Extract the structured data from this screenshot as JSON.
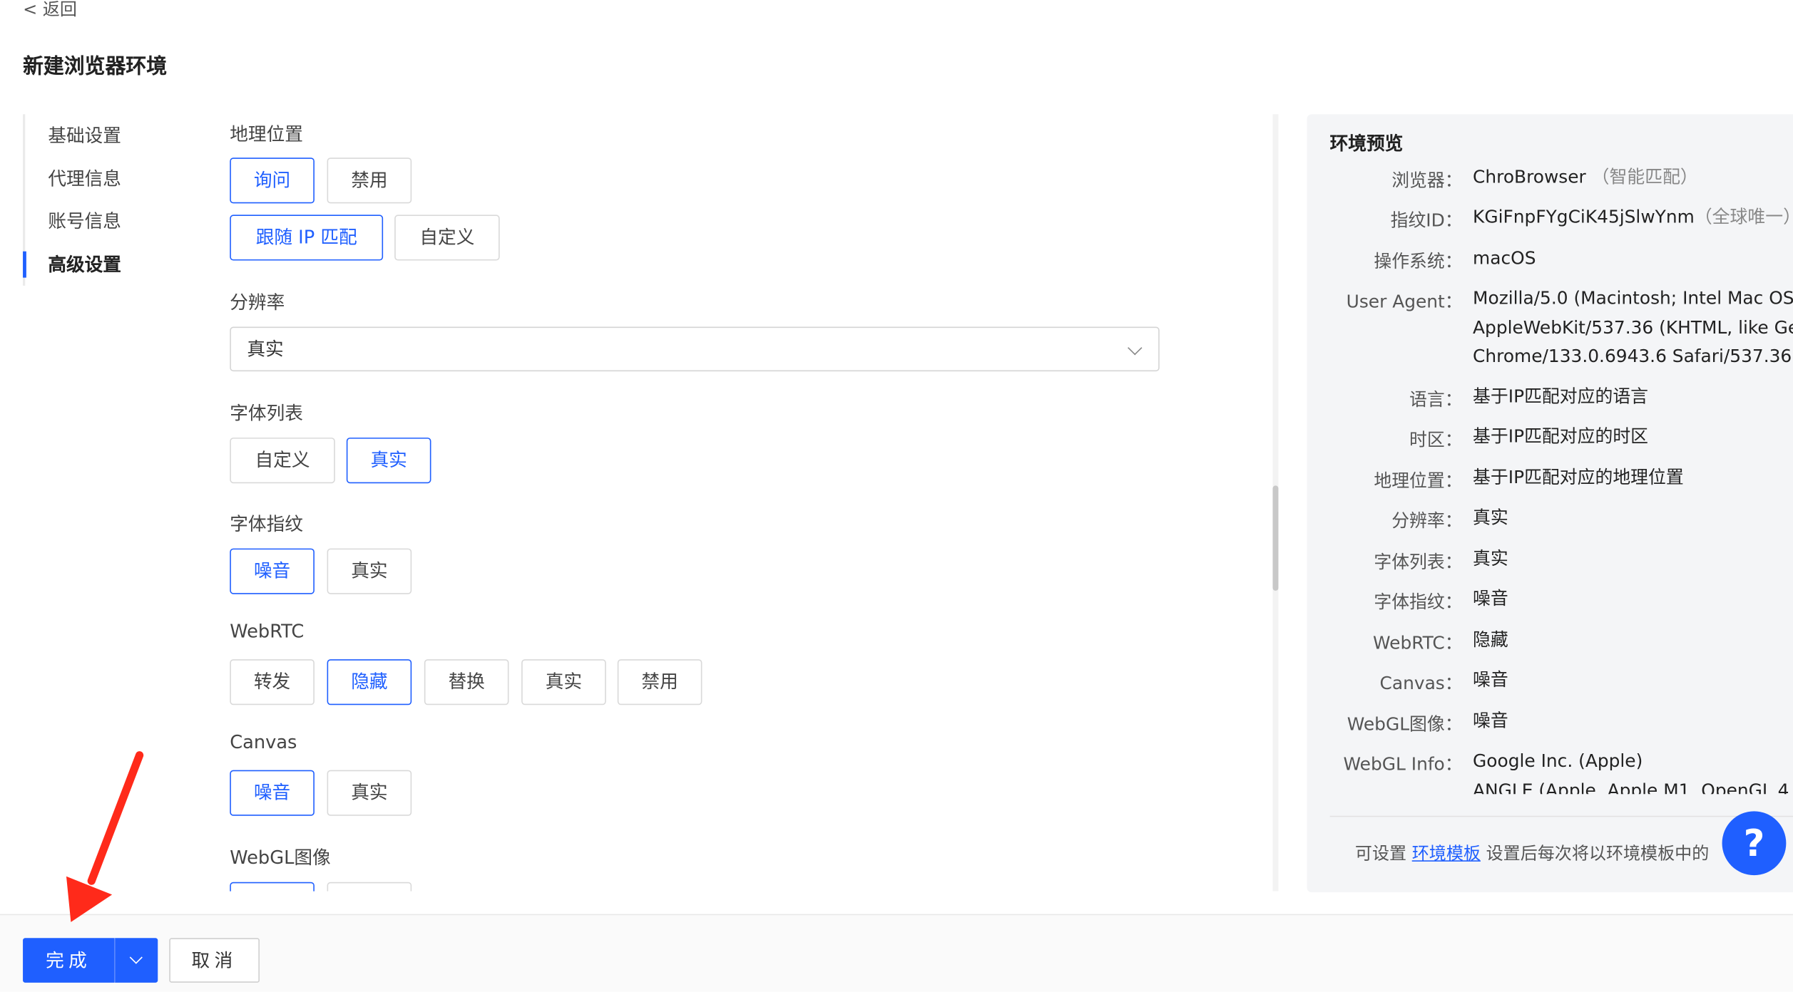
{
  "header": {
    "back_label": "< 返回",
    "title": "新建浏览器环境"
  },
  "nav": {
    "items": [
      {
        "label": "基础设置",
        "active": false
      },
      {
        "label": "代理信息",
        "active": false
      },
      {
        "label": "账号信息",
        "active": false
      },
      {
        "label": "高级设置",
        "active": true
      }
    ]
  },
  "form": {
    "geo": {
      "label": "地理位置",
      "option1": [
        "询问",
        "禁用"
      ],
      "option1_selected": "询问",
      "option2": [
        "跟随 IP 匹配",
        "自定义"
      ],
      "option2_selected": "跟随 IP 匹配"
    },
    "resolution": {
      "label": "分辨率",
      "value": "真实"
    },
    "font_list": {
      "label": "字体列表",
      "options": [
        "自定义",
        "真实"
      ],
      "selected": "真实"
    },
    "font_fp": {
      "label": "字体指纹",
      "options": [
        "噪音",
        "真实"
      ],
      "selected": "噪音"
    },
    "webrtc": {
      "label": "WebRTC",
      "options": [
        "转发",
        "隐藏",
        "替换",
        "真实",
        "禁用"
      ],
      "selected": "隐藏"
    },
    "canvas": {
      "label": "Canvas",
      "options": [
        "噪音",
        "真实"
      ],
      "selected": "噪音"
    },
    "webgl_image": {
      "label": "WebGL图像"
    }
  },
  "preview": {
    "title": "环境预览",
    "rows": [
      {
        "key": "浏览器：",
        "value": "ChroBrowser",
        "note": "（智能匹配）"
      },
      {
        "key": "指纹ID：",
        "value": "KGiFnpFYgCiK45jSlwYnm",
        "note": "（全球唯一）"
      },
      {
        "key": "操作系统：",
        "value": "macOS"
      },
      {
        "key": "User Agent：",
        "value": "Mozilla/5.0 (Macintosh; Intel Mac OS",
        "value2": "AppleWebKit/537.36 (KHTML, like Ge",
        "value3": "Chrome/133.0.6943.6 Safari/537.36"
      },
      {
        "key": "语言：",
        "value": "基于IP匹配对应的语言"
      },
      {
        "key": "时区：",
        "value": "基于IP匹配对应的时区"
      },
      {
        "key": "地理位置：",
        "value": "基于IP匹配对应的地理位置"
      },
      {
        "key": "分辨率：",
        "value": "真实"
      },
      {
        "key": "字体列表：",
        "value": "真实"
      },
      {
        "key": "字体指纹：",
        "value": "噪音"
      },
      {
        "key": "WebRTC：",
        "value": "隐藏"
      },
      {
        "key": "Canvas：",
        "value": "噪音"
      },
      {
        "key": "WebGL图像：",
        "value": "噪音"
      },
      {
        "key": "WebGL Info：",
        "value": "Google Inc. (Apple)",
        "value2": "ANGLE (Apple, Apple M1, OpenGL 4"
      }
    ],
    "note_prefix": "可设置 ",
    "note_link": "环境模板",
    "note_suffix": " 设置后每次将以环境模板中的"
  },
  "help": {
    "label": "?"
  },
  "footer": {
    "done_label": "完成",
    "cancel_label": "取消"
  },
  "colors": {
    "accent": "#1f5fff",
    "arrow": "#ff2a1a",
    "panel_bg": "#f4f5f7"
  }
}
